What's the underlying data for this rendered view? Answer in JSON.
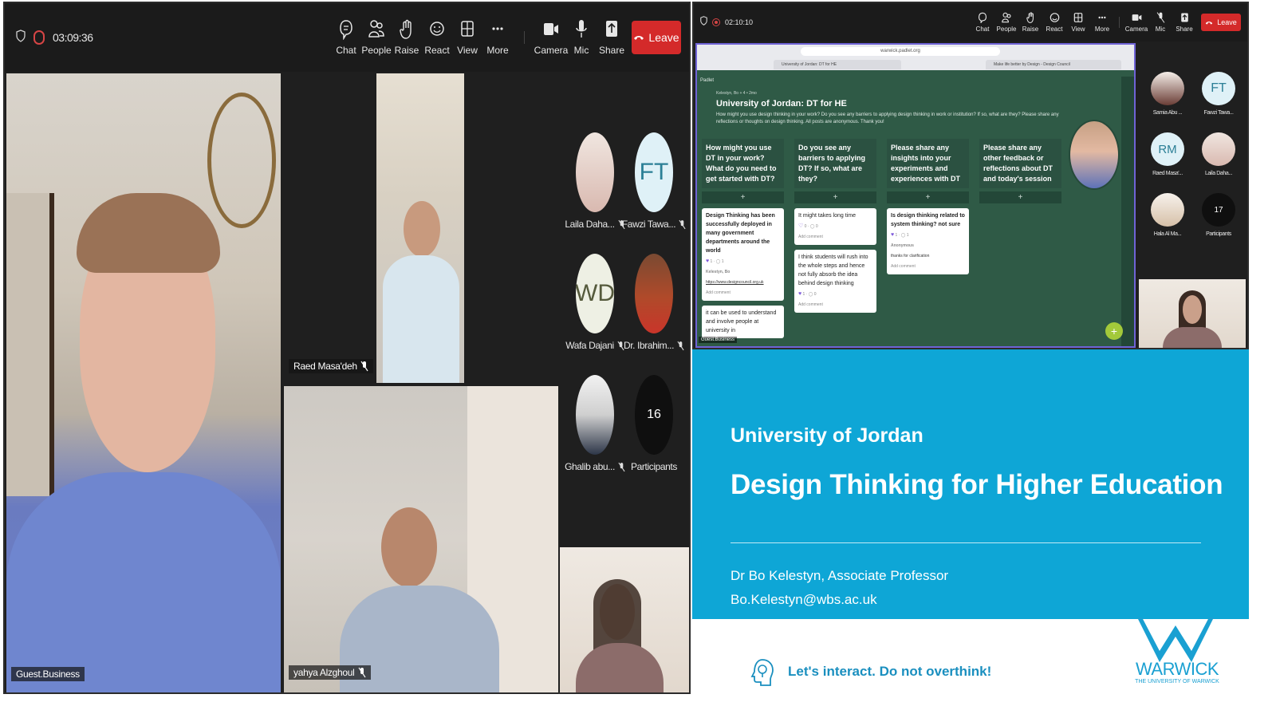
{
  "left_window": {
    "timer": "03:09:36",
    "toolbar": {
      "chat": "Chat",
      "people": "People",
      "raise": "Raise",
      "react": "React",
      "view": "View",
      "more": "More",
      "camera": "Camera",
      "mic": "Mic",
      "share": "Share",
      "leave": "Leave"
    },
    "tiles": {
      "main_speaker": "Guest.Business",
      "raed": "Raed Masa'deh",
      "yahya": "yahya Alzghoul"
    },
    "participants": [
      {
        "name": "Laila Daha...",
        "initials": ""
      },
      {
        "name": "Fawzi Tawa...",
        "initials": "FT"
      },
      {
        "name": "Wafa Dajani",
        "initials": "WD"
      },
      {
        "name": "Dr. Ibrahim...",
        "initials": ""
      },
      {
        "name": "Ghalib abu...",
        "initials": ""
      },
      {
        "name": "Participants",
        "initials": "16"
      }
    ]
  },
  "right_window": {
    "timer": "02:10:10",
    "toolbar": {
      "chat": "Chat",
      "people": "People",
      "raise": "Raise",
      "react": "React",
      "view": "View",
      "more": "More",
      "camera": "Camera",
      "mic": "Mic",
      "share": "Share",
      "leave": "Leave"
    },
    "participants": [
      {
        "name": "Samia Abu ...",
        "initials": ""
      },
      {
        "name": "Fawzi Tawa...",
        "initials": "FT"
      },
      {
        "name": "Raed Masa'...",
        "initials": "RM"
      },
      {
        "name": "Laila Daha...",
        "initials": ""
      },
      {
        "name": "Hala Al Ma...",
        "initials": ""
      },
      {
        "name": "Participants",
        "initials": "17"
      }
    ],
    "share_tag": "Guest.Business",
    "padlet": {
      "url": "warwick.padlet.org",
      "tab1": "University of Jordan: DT for HE",
      "tab2": "Make life better by Design - Design Council",
      "brand": "Padlet",
      "author": "Kelestyn, Bo + 4 • 2mo",
      "title": "University of Jordan: DT for HE",
      "description": "How might you use design thinking in your work? Do you see any barriers to applying design thinking in work or institution? If so, what are they? Please share any reflections or thoughts on design thinking. All posts are anonymous. Thank you!",
      "add": "+",
      "columns": [
        {
          "heading": "How might you use DT in your work? What do you need to get started with DT?",
          "cards": [
            {
              "text": "Design Thinking has been successfully deployed in many government departments around the world",
              "bold": true,
              "likes": "1",
              "comments": "1",
              "author": "Kelestyn, Bo",
              "reply": "https://www.designcouncil.org.uk",
              "add_comment": "Add comment"
            },
            {
              "text": "it can be used to understand and involve people at university in",
              "bold": false,
              "likes": "",
              "comments": "",
              "author": "",
              "reply": "",
              "add_comment": ""
            }
          ]
        },
        {
          "heading": "Do you see any barriers to applying DT? If so, what are they?",
          "cards": [
            {
              "text": "It might takes long time",
              "bold": false,
              "likes": "0",
              "comments": "0",
              "author": "",
              "reply": "",
              "add_comment": "Add comment"
            },
            {
              "text": "I think students will rush into the whole steps and hence not fully absorb the idea behind design thinking",
              "bold": false,
              "likes": "1",
              "comments": "0",
              "author": "",
              "reply": "",
              "add_comment": "Add comment"
            }
          ]
        },
        {
          "heading": "Please share any insights into your experiments and experiences with DT",
          "cards": [
            {
              "text": "Is design thinking related to system thinking? not sure",
              "bold": true,
              "likes": "1",
              "comments": "1",
              "author": "Anonymous",
              "reply": "thanks for clarification",
              "add_comment": "Add comment"
            }
          ]
        },
        {
          "heading": "Please share any other feedback or reflections about DT and today's session",
          "cards": []
        }
      ]
    }
  },
  "slide": {
    "university": "University of Jordan",
    "title": "Design Thinking for Higher Education",
    "presenter": "Dr Bo Kelestyn, Associate Professor",
    "email": "Bo.Kelestyn@wbs.ac.uk",
    "tagline": "Let's interact. Do not overthink!",
    "logo_text": "WARWICK",
    "logo_sub": "THE UNIVERSITY OF WARWICK"
  },
  "colors": {
    "toolbar_bg": "#1b1b1b",
    "leave_red": "#d42a2a",
    "padlet_green": "#2f5a46",
    "slide_blue": "#0ea6d6",
    "warwick_blue": "#1aa0d2"
  }
}
